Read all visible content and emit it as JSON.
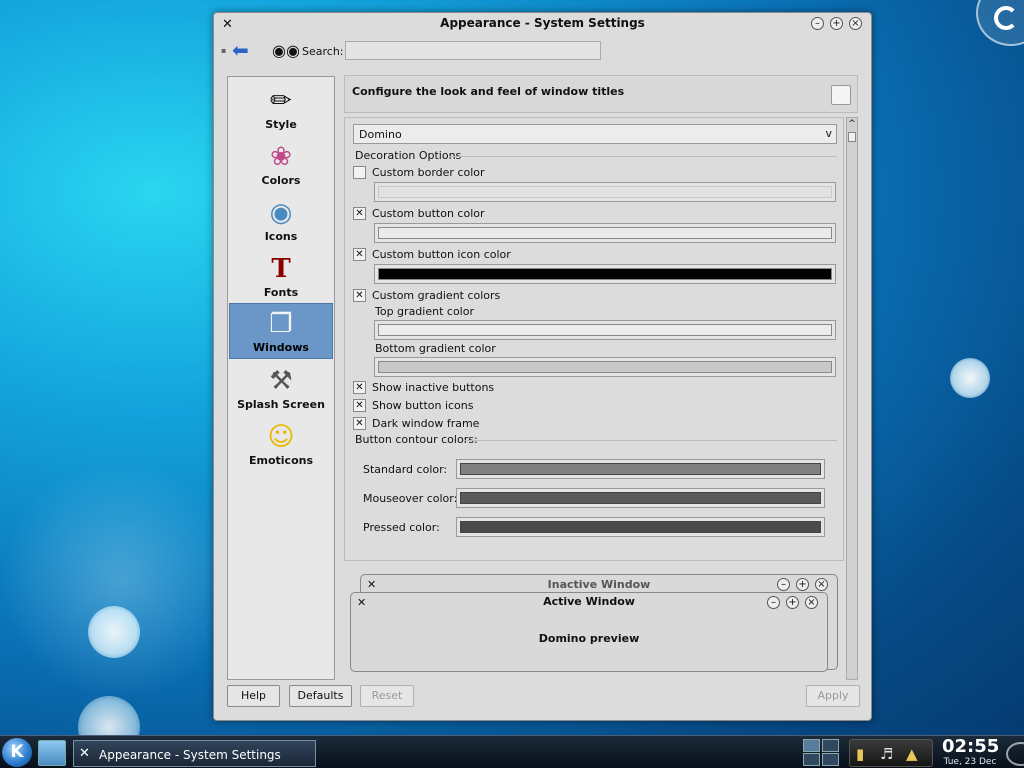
{
  "window": {
    "title": "Appearance - System Settings",
    "app_icon": "tools-icon"
  },
  "toolbar": {
    "search_label": "Search:",
    "search_value": ""
  },
  "sidebar": {
    "items": [
      {
        "label": "Style",
        "icon": "style-icon"
      },
      {
        "label": "Colors",
        "icon": "colors-icon"
      },
      {
        "label": "Icons",
        "icon": "icons-icon"
      },
      {
        "label": "Fonts",
        "icon": "fonts-icon"
      },
      {
        "label": "Windows",
        "icon": "windows-icon",
        "selected": true
      },
      {
        "label": "Splash Screen",
        "icon": "splash-screen-icon"
      },
      {
        "label": "Emoticons",
        "icon": "emoticons-icon"
      }
    ]
  },
  "content": {
    "header": "Configure the look and feel of window titles",
    "decoration": "Domino",
    "decoration_options_label": "Decoration Options",
    "options": {
      "custom_border_color": {
        "label": "Custom border color",
        "checked": false,
        "color": "#e2e2e2"
      },
      "custom_button_color": {
        "label": "Custom button color",
        "checked": true,
        "color": "#eaeaea"
      },
      "custom_button_icon_color": {
        "label": "Custom button icon color",
        "checked": true,
        "color": "#000000"
      },
      "custom_gradient_colors": {
        "label": "Custom gradient colors",
        "checked": true
      },
      "top_gradient_label": "Top gradient color",
      "top_gradient_color": "#ececec",
      "bottom_gradient_label": "Bottom gradient color",
      "bottom_gradient_color": "#c8c8c8",
      "show_inactive_buttons": {
        "label": "Show inactive buttons",
        "checked": true
      },
      "show_button_icons": {
        "label": "Show button icons",
        "checked": true
      },
      "dark_window_frame": {
        "label": "Dark window frame",
        "checked": true
      }
    },
    "contour": {
      "label": "Button contour colors:",
      "standard": {
        "label": "Standard color:",
        "color": "#808080"
      },
      "mouseover": {
        "label": "Mouseover color:",
        "color": "#5a5a5a"
      },
      "pressed": {
        "label": "Pressed color:",
        "color": "#4a4a4a"
      }
    },
    "preview": {
      "inactive_title": "Inactive Window",
      "active_title": "Active Window",
      "text": "Domino preview"
    }
  },
  "buttons": {
    "help": "Help",
    "defaults": "Defaults",
    "reset": "Reset",
    "apply": "Apply"
  },
  "taskbar": {
    "task_title": "Appearance - System Settings",
    "time": "02:55",
    "date": "Tue, 23 Dec"
  },
  "colors": {
    "accent_selected": "#6a97c8"
  }
}
